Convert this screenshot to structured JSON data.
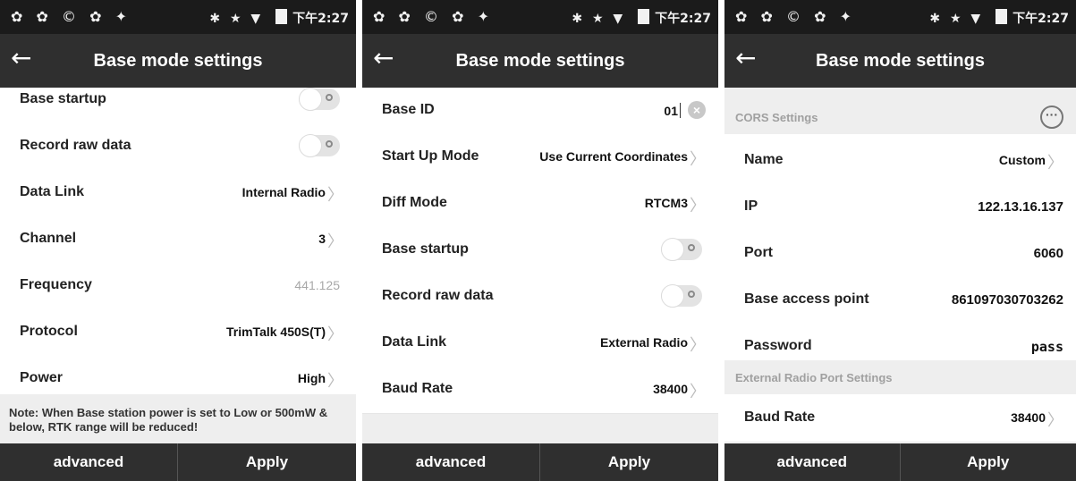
{
  "status_bar": {
    "time": "下午2:27",
    "left_icons": "✿ ✿ © ✿ ✦",
    "right_icons": "✱ ★ ▼"
  },
  "colors": {
    "appbar": "#2f2f2f",
    "statusbar": "#1b1b1b",
    "section": "#eeeeee"
  },
  "screens": [
    {
      "title": "Base mode settings",
      "rows": {
        "base_startup": {
          "label": "Base startup",
          "toggle": false
        },
        "record_raw": {
          "label": "Record raw data",
          "toggle": false
        },
        "data_link": {
          "label": "Data Link",
          "value": "Internal Radio"
        },
        "channel": {
          "label": "Channel",
          "value": "3"
        },
        "frequency": {
          "label": "Frequency",
          "value": "441.125"
        },
        "protocol": {
          "label": "Protocol",
          "value": "TrimTalk 450S(T)"
        },
        "power": {
          "label": "Power",
          "value": "High"
        }
      },
      "note": "Note: When Base station power is set to Low or 500mW & below, RTK range will be reduced!",
      "buttons": {
        "advanced": "advanced",
        "apply": "Apply"
      }
    },
    {
      "title": "Base mode settings",
      "rows": {
        "base_id": {
          "label": "Base ID",
          "value": "01"
        },
        "startup_mode": {
          "label": "Start Up Mode",
          "value": "Use Current Coordinates"
        },
        "diff_mode": {
          "label": "Diff Mode",
          "value": "RTCM3"
        },
        "base_startup": {
          "label": "Base startup",
          "toggle": false
        },
        "record_raw": {
          "label": "Record raw data",
          "toggle": false
        },
        "data_link": {
          "label": "Data Link",
          "value": "External Radio"
        },
        "baud_rate": {
          "label": "Baud Rate",
          "value": "38400"
        }
      },
      "buttons": {
        "advanced": "advanced",
        "apply": "Apply"
      }
    },
    {
      "title": "Base mode settings",
      "section_cors": "CORS Settings",
      "rows": {
        "name": {
          "label": "Name",
          "value": "Custom"
        },
        "ip": {
          "label": "IP",
          "value": "122.13.16.137"
        },
        "port": {
          "label": "Port",
          "value": "6060"
        },
        "access_point": {
          "label": "Base access point",
          "value": "861097030703262"
        },
        "password": {
          "label": "Password",
          "value": "pass"
        },
        "baud_rate": {
          "label": "Baud Rate",
          "value": "38400"
        }
      },
      "section_radio": "External Radio Port Settings",
      "buttons": {
        "advanced": "advanced",
        "apply": "Apply"
      }
    }
  ]
}
